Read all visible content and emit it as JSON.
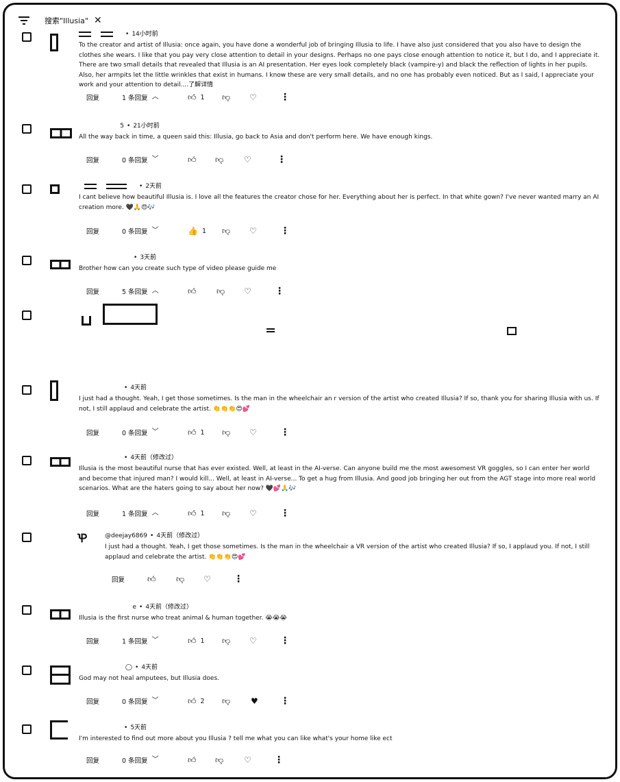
{
  "search_chip": {
    "label": "搜索\"Illusia\"",
    "close": "✕"
  },
  "labels": {
    "reply": "回复"
  },
  "comments": [
    {
      "meta": "14小时前",
      "text": "To the creator and artist of Illusia: once again, you have done a wonderful job of bringing Illusia to life. I have also just considered that you also have to design the clothes she wears. I like that you pay very close attention to detail in your designs. Perhaps no one pays close enough attention to notice it, but I do, and I appreciate it. There are two small details that revealed that Illusia is an AI presentation. Her eyes look completely black (vampire-y) and black the reflection of lights in her pupils. Also, her armpits let the little wrinkles that exist in humans. I know these are very small details, and no one has probably even noticed. But as I said, I appreciate your work and your attention to detail.",
      "more": "...了解详情",
      "replies_label": "1 条回复",
      "likes": "1"
    },
    {
      "meta_prefix": "5",
      "meta": "21小时前",
      "text": "All the way back in time, a queen said this: Illusia, go back to Asia and don't perform here. We have enough kings.",
      "replies_label": "0 条回复",
      "likes": ""
    },
    {
      "meta": "2天前",
      "text": "I cant believe how beautiful Illusia is. I love all the features the creator chose for her. Everything about her is perfect. In that white gown? I've never wanted marry an AI creation more. 🖤🙏😍🎶",
      "replies_label": "0 条回复",
      "likes": "1"
    },
    {
      "meta": "3天前",
      "text": "Brother how can you create such type of video please guide me",
      "replies_label": "5 条回复",
      "likes": ""
    },
    {
      "meta": "4天前",
      "text": "I just had a thought. Yeah, I get those sometimes. Is the man in the wheelchair an r version of the artist who created Illusia? If so, thank you for sharing Illusia with us. If not, I still applaud and celebrate the artist. 👏👏👏😍💕",
      "replies_label": "0 条回复",
      "likes": "1"
    },
    {
      "meta": "4天前（修改过）",
      "text": "Illusia is the most beautiful nurse that has ever existed. Well, at least in the AI-verse. Can anyone build me the most awesomest VR goggles, so I can enter her world and become that injured man? I would kill... Well, at least in AI-verse... To get a hug from Illusia. And good job bringing her out from the AGT stage into more real world scenarios. What are the haters going to say about her now? 🖤💕🙏🎶",
      "replies_label": "1 条回复",
      "likes": "1"
    }
  ],
  "reply_item": {
    "author": "@deejay6869",
    "meta": "4天前（修改过）",
    "text": "I just had a thought. Yeah, I get those sometimes. Is the man in the wheelchair a VR version of the artist who created Illusia? If so, I applaud you. If not, I still applaud and celebrate the artist. 👏👏👏😍💕"
  },
  "comments2": [
    {
      "meta_prefix": "e",
      "meta": "4天前（修改过）",
      "text": "Illusia is the first nurse who treat animal & human together. 😭😭😭",
      "replies_label": "1 条回复",
      "likes": "1"
    },
    {
      "meta": "4天前",
      "text": "God may not heal amputees, but Illusia does.",
      "replies_label": "0 条回复",
      "likes": "2"
    },
    {
      "meta": "5天前",
      "text": "I'm interested to find out more about you Illusia ? tell me what you can like what's your home like ect",
      "replies_label": "0 条回复",
      "likes": ""
    }
  ],
  "icons": {
    "like": "thumb-up-icon",
    "dislike": "thumb-down-icon",
    "heart": "heart-icon",
    "more": "more-vert-icon",
    "filter": "filter-icon"
  }
}
